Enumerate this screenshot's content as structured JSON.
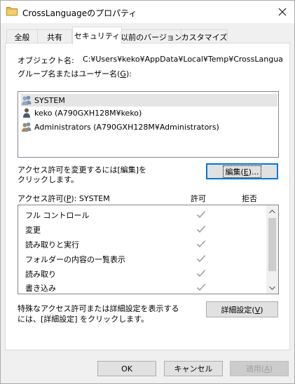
{
  "window": {
    "title": "CrossLanguageのプロパティ",
    "close_glyph": "✕"
  },
  "tabs": [
    {
      "label": "全般",
      "active": false
    },
    {
      "label": "共有",
      "active": false
    },
    {
      "label": "セキュリティ",
      "active": true
    },
    {
      "label": "以前のバージョン",
      "active": false
    },
    {
      "label": "カスタマイズ",
      "active": false
    }
  ],
  "security": {
    "object_name_label": "オブジェクト名:",
    "object_name_value": "C:¥Users¥keko¥AppData¥Local¥Temp¥CrossLanguage",
    "group_label_pre": "グループ名またはユーザー名(",
    "group_label_key": "G",
    "group_label_post": "):",
    "users": [
      {
        "name": "SYSTEM",
        "icon": "group-users-icon",
        "selected": true
      },
      {
        "name": "keko (A790GXH128M¥keko)",
        "icon": "single-user-icon",
        "selected": false
      },
      {
        "name": "Administrators (A790GXH128M¥Administrators)",
        "icon": "group-users-icon",
        "selected": false
      }
    ],
    "change_text_line1": "アクセス許可を変更するには[編集]を",
    "change_text_line2": "クリックします。",
    "edit_button_pre": "編集(",
    "edit_button_key": "E",
    "edit_button_post": ")...",
    "perm_header_pre": "アクセス許可(",
    "perm_header_key": "P",
    "perm_header_post": "): SYSTEM",
    "allow_header": "許可",
    "deny_header": "拒否",
    "permissions": [
      {
        "name": "フル コントロール",
        "allow": true,
        "deny": false
      },
      {
        "name": "変更",
        "allow": true,
        "deny": false
      },
      {
        "name": "読み取りと実行",
        "allow": true,
        "deny": false
      },
      {
        "name": "フォルダーの内容の一覧表示",
        "allow": true,
        "deny": false
      },
      {
        "name": "読み取り",
        "allow": true,
        "deny": false
      },
      {
        "name": "書き込み",
        "allow": true,
        "deny": false
      }
    ],
    "advanced_text_line1": "特殊なアクセス許可または詳細設定を表示する",
    "advanced_text_line2": "には、[詳細設定] をクリックします。",
    "advanced_button_pre": "詳細設定(",
    "advanced_button_key": "V",
    "advanced_button_post": ")"
  },
  "footer": {
    "ok_label": "OK",
    "cancel_label": "キャンセル",
    "apply_pre": "適用(",
    "apply_key": "A",
    "apply_post": ")"
  },
  "colors": {
    "focus_blue": "#0078d7",
    "check_gray": "#a0a0a0",
    "selection_gray": "#e5e5e5"
  }
}
